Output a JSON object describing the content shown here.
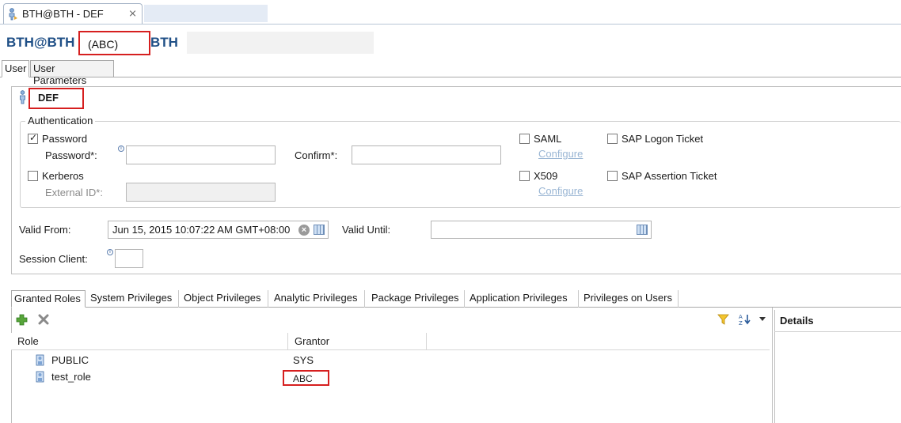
{
  "editor_tab": {
    "title": "BTH@BTH - DEF",
    "close_glyph": "⨯"
  },
  "header": {
    "left": "BTH@BTH",
    "highlight": "(ABC)",
    "right": "BTH"
  },
  "inner_tabs": [
    {
      "label": "User",
      "active": true
    },
    {
      "label": "User Parameters",
      "active": false
    }
  ],
  "user": {
    "name": "DEF"
  },
  "authentication": {
    "group_title": "Authentication",
    "password": {
      "label": "Password",
      "checked": true,
      "field_label": "Password*:",
      "value": "",
      "confirm_label": "Confirm*:",
      "confirm_value": ""
    },
    "kerberos": {
      "label": "Kerberos",
      "checked": false,
      "field_label": "External ID*:",
      "value": ""
    },
    "saml": {
      "label": "SAML",
      "configure": "Configure"
    },
    "x509": {
      "label": "X509",
      "configure": "Configure"
    },
    "logon_ticket": {
      "label": "SAP Logon Ticket"
    },
    "assertion_ticket": {
      "label": "SAP Assertion Ticket"
    }
  },
  "validity": {
    "from_label": "Valid From:",
    "from_value": "Jun 15, 2015 10:07:22 AM GMT+08:00",
    "until_label": "Valid Until:",
    "until_value": ""
  },
  "session_client": {
    "label": "Session Client:",
    "value": ""
  },
  "privilege_tabs": [
    "Granted Roles",
    "System Privileges",
    "Object Privileges",
    "Analytic Privileges",
    "Package Privileges",
    "Application Privileges",
    "Privileges on Users"
  ],
  "roles_table": {
    "columns": [
      "Role",
      "Grantor"
    ],
    "rows": [
      {
        "role": "PUBLIC",
        "grantor": "SYS"
      },
      {
        "role": "test_role",
        "grantor": "ABC"
      }
    ]
  },
  "details": {
    "title": "Details"
  },
  "icons": {
    "add": "plus-icon",
    "remove": "delete-icon",
    "filter": "filter-icon",
    "sort": "sort-icon",
    "menu": "dropdown-menu-icon"
  },
  "colors": {
    "header_text": "#1f4f86",
    "highlight_border": "#d61f1f",
    "link": "#9ab6d4"
  }
}
